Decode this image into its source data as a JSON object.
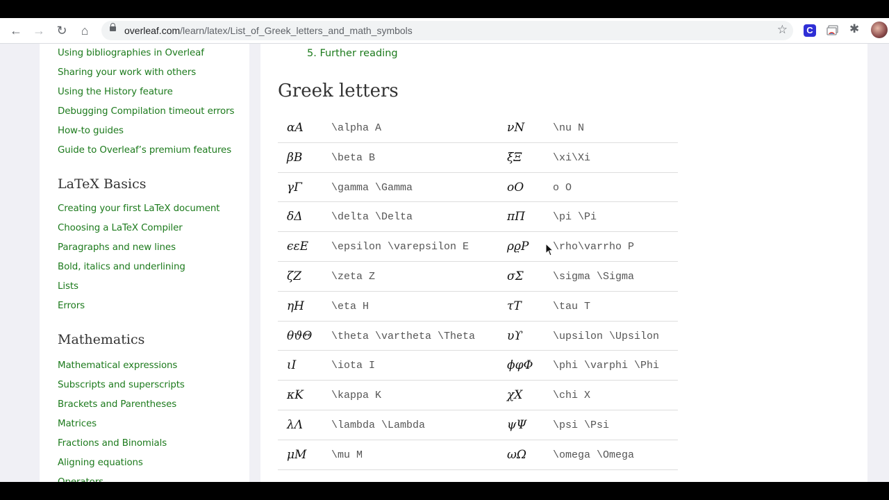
{
  "browser": {
    "url_host": "overleaf.com",
    "url_path": "/learn/latex/List_of_Greek_letters_and_math_symbols",
    "extension_c_label": "C",
    "icons": [
      "back-icon",
      "forward-icon",
      "reload-icon",
      "home-icon",
      "lock-icon",
      "bookmark-star-icon",
      "extension-c-icon",
      "cast-icon",
      "extensions-puzzle-icon",
      "profile-avatar"
    ]
  },
  "sidebar": {
    "links_top": [
      "Using bibliographies in Overleaf",
      "Sharing your work with others",
      "Using the History feature",
      "Debugging Compilation timeout errors",
      "How-to guides",
      "Guide to Overleaf’s premium features"
    ],
    "section_basics": "LaTeX Basics",
    "links_basics": [
      "Creating your first LaTeX document",
      "Choosing a LaTeX Compiler",
      "Paragraphs and new lines",
      "Bold, italics and underlining",
      "Lists",
      "Errors"
    ],
    "section_math": "Mathematics",
    "links_math": [
      "Mathematical expressions",
      "Subscripts and superscripts",
      "Brackets and Parentheses",
      "Matrices",
      "Fractions and Binomials",
      "Aligning equations",
      "Operators"
    ]
  },
  "main": {
    "toc_item": "5. Further reading",
    "heading": "Greek letters",
    "rows": [
      {
        "sym1": "αA",
        "cmd1": "\\alpha A",
        "sym2": "νN",
        "cmd2": "\\nu N"
      },
      {
        "sym1": "βB",
        "cmd1": "\\beta B",
        "sym2": "ξΞ",
        "cmd2": "\\xi\\Xi"
      },
      {
        "sym1": "γΓ",
        "cmd1": "\\gamma \\Gamma",
        "sym2": "oO",
        "cmd2": "o O"
      },
      {
        "sym1": "δΔ",
        "cmd1": "\\delta \\Delta",
        "sym2": "πΠ",
        "cmd2": "\\pi \\Pi"
      },
      {
        "sym1": "ϵεE",
        "cmd1": "\\epsilon \\varepsilon E",
        "sym2": "ρϱP",
        "cmd2": "\\rho\\varrho P"
      },
      {
        "sym1": "ζZ",
        "cmd1": "\\zeta Z",
        "sym2": "σΣ",
        "cmd2": "\\sigma \\Sigma"
      },
      {
        "sym1": "ηH",
        "cmd1": "\\eta H",
        "sym2": "τT",
        "cmd2": "\\tau T"
      },
      {
        "sym1": "θϑΘ",
        "cmd1": "\\theta \\vartheta \\Theta",
        "sym2": "υϒ",
        "cmd2": "\\upsilon \\Upsilon"
      },
      {
        "sym1": "ιI",
        "cmd1": "\\iota I",
        "sym2": "ϕφΦ",
        "cmd2": "\\phi \\varphi \\Phi"
      },
      {
        "sym1": "κK",
        "cmd1": "\\kappa K",
        "sym2": "χX",
        "cmd2": "\\chi X"
      },
      {
        "sym1": "λΛ",
        "cmd1": "\\lambda \\Lambda",
        "sym2": "ψΨ",
        "cmd2": "\\psi \\Psi"
      },
      {
        "sym1": "μM",
        "cmd1": "\\mu M",
        "sym2": "ωΩ",
        "cmd2": "\\omega \\Omega"
      }
    ]
  }
}
